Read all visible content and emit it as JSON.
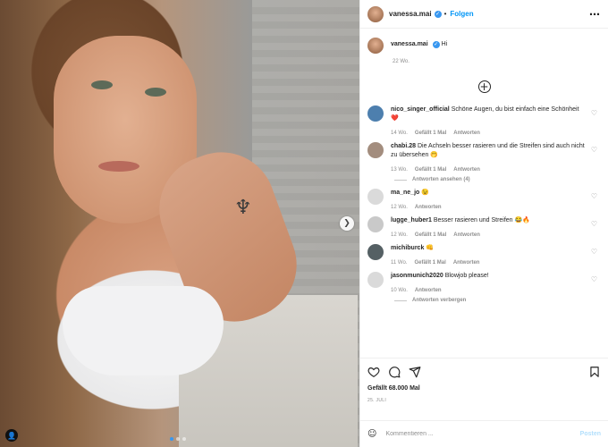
{
  "post": {
    "username": "vanessa.mai",
    "follow_label": "Folgen",
    "separator": "•",
    "more_icon": "more-horizontal-icon"
  },
  "caption": {
    "username": "vanessa.mai",
    "text": "Hi",
    "time": "22 Wo."
  },
  "load_more_icon": "plus-circle-icon",
  "comments": [
    {
      "username": "nico_singer_official",
      "text": "Schöne Augen, du bist einfach eine Schönheit ❤️",
      "time": "14 Wo.",
      "likes": "Gefällt 1 Mal",
      "reply": "Antworten",
      "avatar_color": "#4d7fae"
    },
    {
      "username": "chabi.28",
      "text": "Die Achseln besser rasieren und die Streifen sind auch nicht zu übersehen 🤭",
      "time": "13 Wo.",
      "likes": "Gefällt 1 Mal",
      "reply": "Antworten",
      "avatar_color": "#a38d7e",
      "replies_label": "Antworten ansehen (4)"
    },
    {
      "username": "ma_ne_jo",
      "text": "😉",
      "time": "12 Wo.",
      "likes": "",
      "reply": "Antworten",
      "avatar_color": "#dadada"
    },
    {
      "username": "lugge_huber1",
      "text": "Besser rasieren und Streifen 😂🔥",
      "time": "12 Wo.",
      "likes": "Gefällt 1 Mal",
      "reply": "Antworten",
      "avatar_color": "#c9c9c9"
    },
    {
      "username": "michiburck",
      "text": "👊",
      "time": "11 Wo.",
      "likes": "Gefällt 1 Mal",
      "reply": "Antworten",
      "avatar_color": "#556064"
    },
    {
      "username": "jasonmunich2020",
      "text": "Blowjob please!",
      "time": "10 Wo.",
      "likes": "",
      "reply": "Antworten",
      "avatar_color": "#dadada",
      "replies_label": "Antworten verbergen"
    }
  ],
  "actions": {
    "like_icon": "heart-icon",
    "comment_icon": "comment-icon",
    "share_icon": "send-icon",
    "save_icon": "bookmark-icon",
    "likes_label": "Gefällt 68.000 Mal",
    "date_label": "25. JULI"
  },
  "add_comment": {
    "emoji_icon": "smiley-icon",
    "placeholder": "Kommentieren ...",
    "post_label": "Posten"
  },
  "colors": {
    "accent": "#0095f6",
    "muted": "#8e8e8e",
    "verified": "#3897f0"
  }
}
